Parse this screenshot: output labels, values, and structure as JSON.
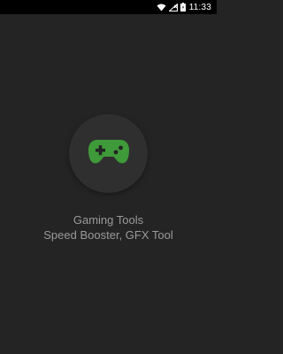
{
  "status_bar": {
    "time": "11:33",
    "icons": [
      "wifi-icon",
      "signal-icon",
      "battery-icon"
    ]
  },
  "splash": {
    "icon": "gamepad-icon",
    "icon_color": "#3f9a3a",
    "circle_color": "#2f2f2f",
    "title": "Gaming Tools",
    "subtitle": "Speed Booster, GFX Tool"
  },
  "colors": {
    "background": "#242424",
    "status_bar": "#000000",
    "text": "#9a9a9a"
  }
}
